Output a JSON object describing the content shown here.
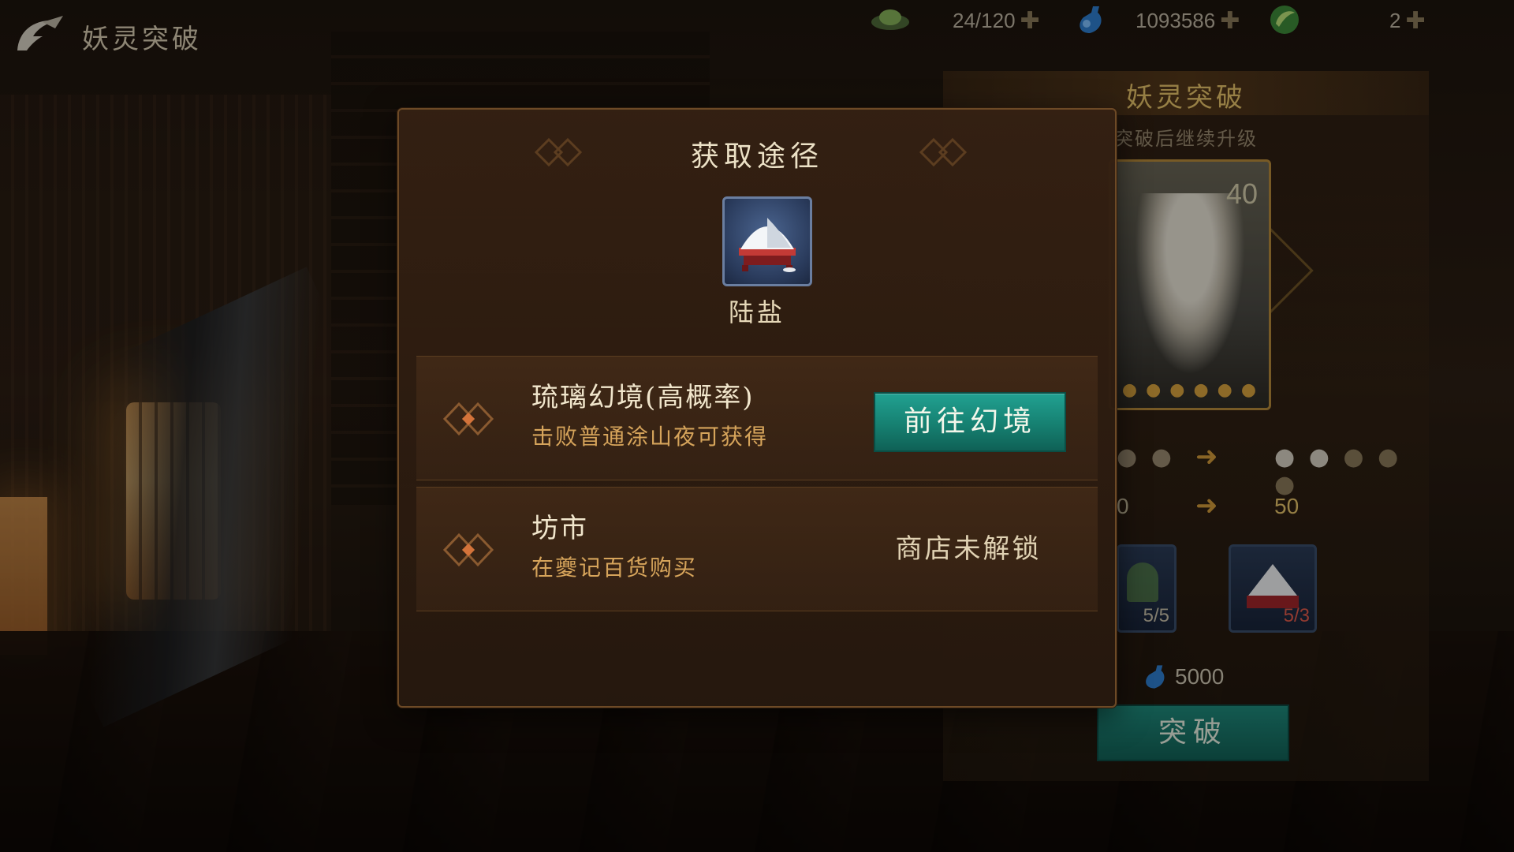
{
  "topbar": {
    "title": "妖灵突破",
    "resources": [
      {
        "icon": "jade-icon",
        "value": "24/120"
      },
      {
        "icon": "spirit-bottle-icon",
        "value": "1093586"
      },
      {
        "icon": "leaf-coin-icon",
        "value": "2"
      }
    ]
  },
  "right_panel": {
    "title": "妖灵突破",
    "subtitle": "突破后继续升级",
    "card_level": "40",
    "level_from": "0",
    "level_to": "50",
    "materials": [
      {
        "icon": "herb-icon",
        "count": "5/5"
      },
      {
        "icon": "salt-icon",
        "count": "5/3"
      }
    ],
    "cost": "5000",
    "break_button": "突破"
  },
  "dialog": {
    "title": "获取途径",
    "item_name": "陆盐",
    "routes": [
      {
        "name": "琉璃幻境(高概率)",
        "desc": "击败普通涂山夜可获得",
        "button": "前往幻境"
      },
      {
        "name": "坊市",
        "desc": "在夔记百货购买",
        "status": "商店未解锁"
      }
    ]
  },
  "colors": {
    "accent_gold": "#e6c36a",
    "button_teal": "#168071",
    "desc_orange": "#d6a45b"
  }
}
